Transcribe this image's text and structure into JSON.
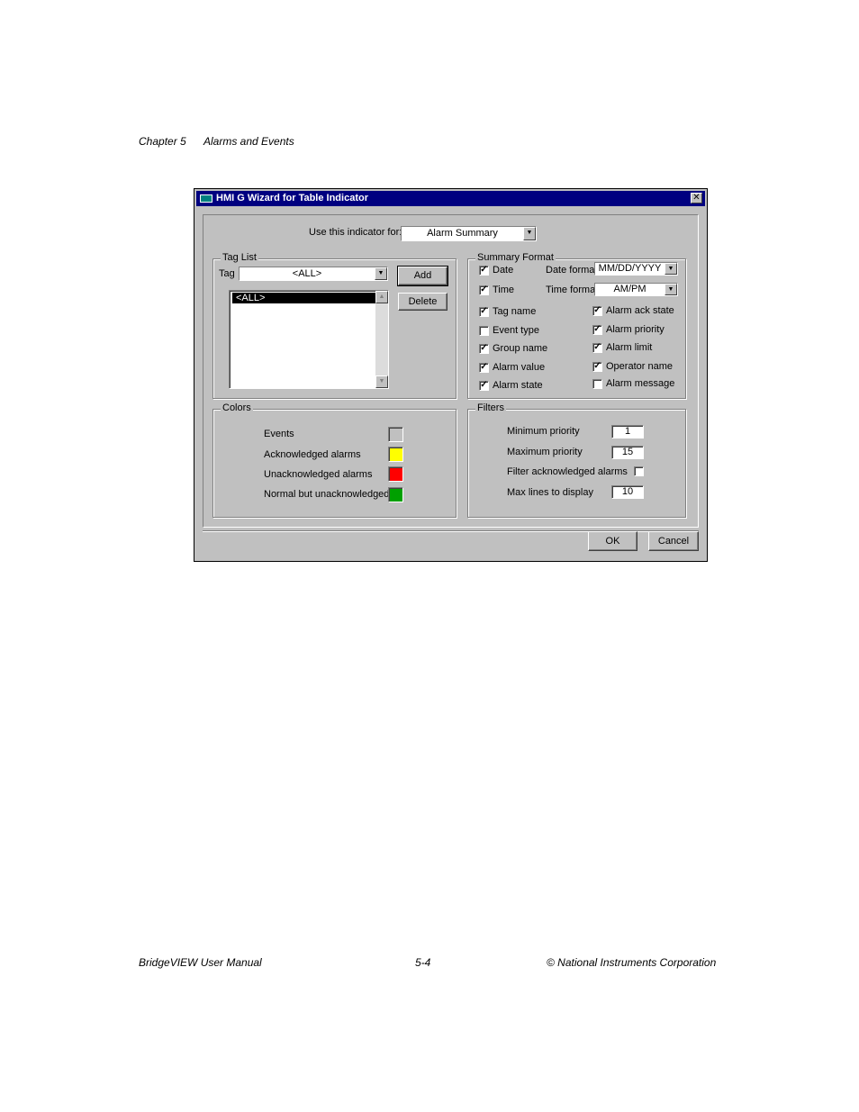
{
  "page": {
    "header_chapter": "Chapter 5",
    "header_title": "Alarms and Events",
    "footer_left": "BridgeVIEW User Manual",
    "footer_center": "5-4",
    "footer_right": "© National Instruments Corporation"
  },
  "dialog": {
    "title": "HMI G Wizard for Table Indicator",
    "close_glyph": "✕",
    "use_for_label": "Use this indicator for:",
    "use_for_value": "Alarm Summary",
    "tag_list": {
      "title": "Tag List",
      "tag_label": "Tag",
      "tag_value": "<ALL>",
      "add_label": "Add",
      "delete_label": "Delete",
      "items": [
        "<ALL>"
      ]
    },
    "summary_format": {
      "title": "Summary Format",
      "date_label": "Date",
      "date_checked": true,
      "date_format_label": "Date format",
      "date_format_value": "MM/DD/YYYY",
      "time_label": "Time",
      "time_checked": true,
      "time_format_label": "Time format",
      "time_format_value": "AM/PM",
      "left_options": [
        {
          "label": "Tag name",
          "checked": true
        },
        {
          "label": "Event type",
          "checked": false
        },
        {
          "label": "Group name",
          "checked": true
        },
        {
          "label": "Alarm value",
          "checked": true
        },
        {
          "label": "Alarm state",
          "checked": true
        }
      ],
      "right_options": [
        {
          "label": "Alarm ack state",
          "checked": true
        },
        {
          "label": "Alarm priority",
          "checked": true
        },
        {
          "label": "Alarm limit",
          "checked": true
        },
        {
          "label": "Operator name",
          "checked": true
        },
        {
          "label": "Alarm message",
          "checked": false
        }
      ]
    },
    "colors": {
      "title": "Colors",
      "items": [
        {
          "label": "Events",
          "color": "#c0c0c0"
        },
        {
          "label": "Acknowledged alarms",
          "color": "#ffff00"
        },
        {
          "label": "Unacknowledged alarms",
          "color": "#ff0000"
        },
        {
          "label": "Normal but unacknowledged",
          "color": "#00a000"
        }
      ]
    },
    "filters": {
      "title": "Filters",
      "min_priority_label": "Minimum priority",
      "min_priority_value": "1",
      "max_priority_label": "Maximum priority",
      "max_priority_value": "15",
      "filter_ack_label": "Filter acknowledged alarms",
      "filter_ack_checked": false,
      "max_lines_label": "Max lines to display",
      "max_lines_value": "10"
    },
    "ok_label": "OK",
    "cancel_label": "Cancel",
    "check_glyph": "✓",
    "dropdown_glyph": "▼",
    "scroll_up_glyph": "▲",
    "scroll_down_glyph": "▼"
  }
}
